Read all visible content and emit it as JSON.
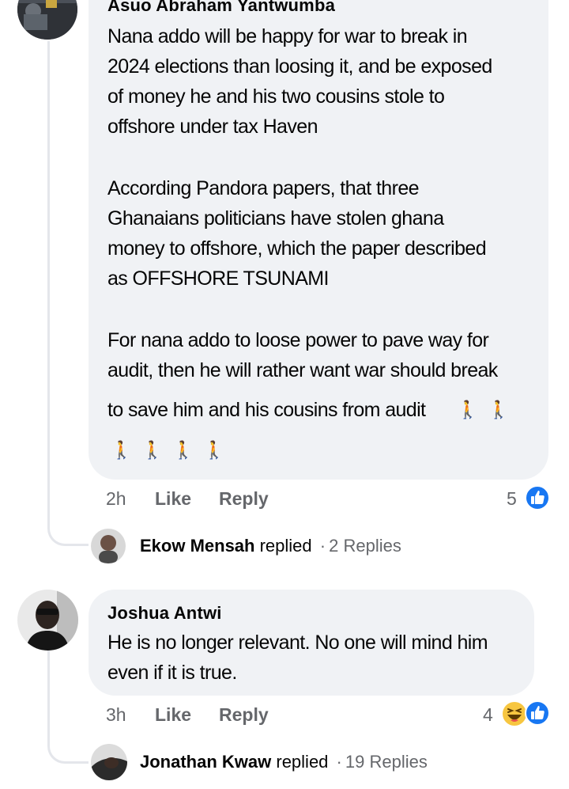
{
  "comments": [
    {
      "author": "Asuo Abraham Yantwumba",
      "lines": [
        "Nana addo will be happy for war to break in",
        "2024 elections than loosing it, and be exposed",
        "of money he and his two cousins stole to",
        "offshore under tax Haven",
        "According Pandora papers, that three",
        "Ghanaians politicians have stolen ghana",
        "money to offshore, which the paper described",
        "as OFFSHORE TSUNAMI",
        "For nana addo to loose power to pave way for",
        "audit, then he will rather want war should break",
        "to save him and his cousins from audit"
      ],
      "time": "2h",
      "like_label": "Like",
      "reply_label": "Reply",
      "reaction_count": "5",
      "reactions": [
        "like-icon"
      ],
      "replies": {
        "author": "Ekow Mensah",
        "verb": "replied",
        "separator": "·",
        "count": "2 Replies"
      }
    },
    {
      "author": "Joshua Antwi",
      "lines": [
        "He is no longer relevant. No one will mind him",
        "even if it is true."
      ],
      "time": "3h",
      "like_label": "Like",
      "reply_label": "Reply",
      "reaction_count": "4",
      "reactions": [
        "haha-icon",
        "like-icon"
      ],
      "replies": {
        "author": "Jonathan Kwaw",
        "verb": "replied",
        "separator": "·",
        "count": "19 Replies"
      }
    }
  ],
  "colors": {
    "bubble": "#f0f2f5",
    "like_blue": "#1877f2",
    "meta_gray": "#65676b",
    "thread_line": "#e4e6eb"
  }
}
